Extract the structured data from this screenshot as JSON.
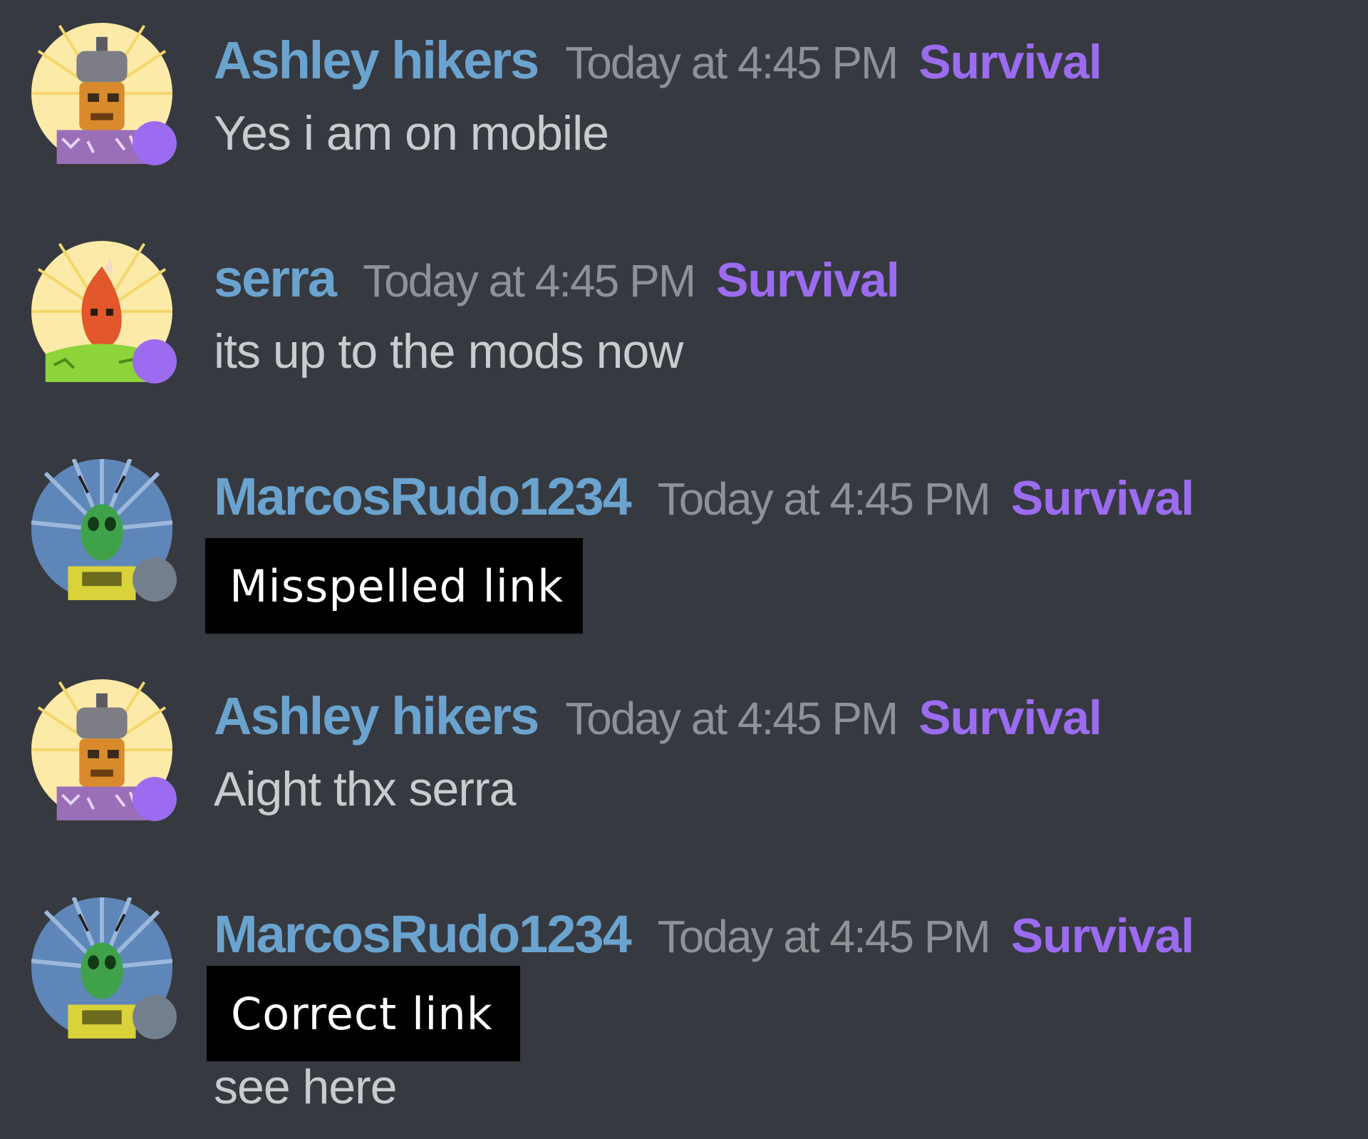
{
  "colors": {
    "background": "#36393f",
    "username": "#6ba3cf",
    "timestamp": "#8e9297",
    "role": "#9b6cf0",
    "message_text": "#c9cbcf",
    "status_online": "#9b6cf0",
    "status_offline": "#747f8d",
    "redaction_box": "#000000"
  },
  "messages": [
    {
      "username": "Ashley hikers",
      "timestamp": "Today at 4:45 PM",
      "role": "Survival",
      "avatar_icon": "robot-helmet-avatar-icon",
      "status": "online",
      "text": "Yes i am on mobile"
    },
    {
      "username": "serra",
      "timestamp": "Today at 4:45 PM",
      "role": "Survival",
      "avatar_icon": "fire-creature-avatar-icon",
      "status": "online",
      "text": "its up to the mods now"
    },
    {
      "username": "MarcosRudo1234",
      "timestamp": "Today at 4:45 PM",
      "role": "Survival",
      "avatar_icon": "green-alien-avatar-icon",
      "status": "offline",
      "annotation": "Misspelled link"
    },
    {
      "username": "Ashley hikers",
      "timestamp": "Today at 4:45 PM",
      "role": "Survival",
      "avatar_icon": "robot-helmet-avatar-icon",
      "status": "online",
      "text": "Aight thx serra"
    },
    {
      "username": "MarcosRudo1234",
      "timestamp": "Today at 4:45 PM",
      "role": "Survival",
      "avatar_icon": "green-alien-avatar-icon",
      "status": "offline",
      "annotation": "Correct link",
      "text": "see here"
    }
  ]
}
